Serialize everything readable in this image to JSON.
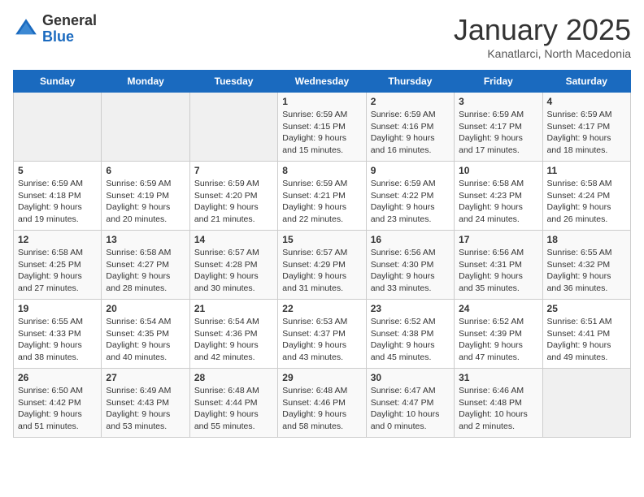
{
  "header": {
    "logo_general": "General",
    "logo_blue": "Blue",
    "title": "January 2025",
    "subtitle": "Kanatlarci, North Macedonia"
  },
  "days_of_week": [
    "Sunday",
    "Monday",
    "Tuesday",
    "Wednesday",
    "Thursday",
    "Friday",
    "Saturday"
  ],
  "weeks": [
    [
      {
        "day": "",
        "sunrise": "",
        "sunset": "",
        "daylight": ""
      },
      {
        "day": "",
        "sunrise": "",
        "sunset": "",
        "daylight": ""
      },
      {
        "day": "",
        "sunrise": "",
        "sunset": "",
        "daylight": ""
      },
      {
        "day": "1",
        "sunrise": "Sunrise: 6:59 AM",
        "sunset": "Sunset: 4:15 PM",
        "daylight": "Daylight: 9 hours and 15 minutes."
      },
      {
        "day": "2",
        "sunrise": "Sunrise: 6:59 AM",
        "sunset": "Sunset: 4:16 PM",
        "daylight": "Daylight: 9 hours and 16 minutes."
      },
      {
        "day": "3",
        "sunrise": "Sunrise: 6:59 AM",
        "sunset": "Sunset: 4:17 PM",
        "daylight": "Daylight: 9 hours and 17 minutes."
      },
      {
        "day": "4",
        "sunrise": "Sunrise: 6:59 AM",
        "sunset": "Sunset: 4:17 PM",
        "daylight": "Daylight: 9 hours and 18 minutes."
      }
    ],
    [
      {
        "day": "5",
        "sunrise": "Sunrise: 6:59 AM",
        "sunset": "Sunset: 4:18 PM",
        "daylight": "Daylight: 9 hours and 19 minutes."
      },
      {
        "day": "6",
        "sunrise": "Sunrise: 6:59 AM",
        "sunset": "Sunset: 4:19 PM",
        "daylight": "Daylight: 9 hours and 20 minutes."
      },
      {
        "day": "7",
        "sunrise": "Sunrise: 6:59 AM",
        "sunset": "Sunset: 4:20 PM",
        "daylight": "Daylight: 9 hours and 21 minutes."
      },
      {
        "day": "8",
        "sunrise": "Sunrise: 6:59 AM",
        "sunset": "Sunset: 4:21 PM",
        "daylight": "Daylight: 9 hours and 22 minutes."
      },
      {
        "day": "9",
        "sunrise": "Sunrise: 6:59 AM",
        "sunset": "Sunset: 4:22 PM",
        "daylight": "Daylight: 9 hours and 23 minutes."
      },
      {
        "day": "10",
        "sunrise": "Sunrise: 6:58 AM",
        "sunset": "Sunset: 4:23 PM",
        "daylight": "Daylight: 9 hours and 24 minutes."
      },
      {
        "day": "11",
        "sunrise": "Sunrise: 6:58 AM",
        "sunset": "Sunset: 4:24 PM",
        "daylight": "Daylight: 9 hours and 26 minutes."
      }
    ],
    [
      {
        "day": "12",
        "sunrise": "Sunrise: 6:58 AM",
        "sunset": "Sunset: 4:25 PM",
        "daylight": "Daylight: 9 hours and 27 minutes."
      },
      {
        "day": "13",
        "sunrise": "Sunrise: 6:58 AM",
        "sunset": "Sunset: 4:27 PM",
        "daylight": "Daylight: 9 hours and 28 minutes."
      },
      {
        "day": "14",
        "sunrise": "Sunrise: 6:57 AM",
        "sunset": "Sunset: 4:28 PM",
        "daylight": "Daylight: 9 hours and 30 minutes."
      },
      {
        "day": "15",
        "sunrise": "Sunrise: 6:57 AM",
        "sunset": "Sunset: 4:29 PM",
        "daylight": "Daylight: 9 hours and 31 minutes."
      },
      {
        "day": "16",
        "sunrise": "Sunrise: 6:56 AM",
        "sunset": "Sunset: 4:30 PM",
        "daylight": "Daylight: 9 hours and 33 minutes."
      },
      {
        "day": "17",
        "sunrise": "Sunrise: 6:56 AM",
        "sunset": "Sunset: 4:31 PM",
        "daylight": "Daylight: 9 hours and 35 minutes."
      },
      {
        "day": "18",
        "sunrise": "Sunrise: 6:55 AM",
        "sunset": "Sunset: 4:32 PM",
        "daylight": "Daylight: 9 hours and 36 minutes."
      }
    ],
    [
      {
        "day": "19",
        "sunrise": "Sunrise: 6:55 AM",
        "sunset": "Sunset: 4:33 PM",
        "daylight": "Daylight: 9 hours and 38 minutes."
      },
      {
        "day": "20",
        "sunrise": "Sunrise: 6:54 AM",
        "sunset": "Sunset: 4:35 PM",
        "daylight": "Daylight: 9 hours and 40 minutes."
      },
      {
        "day": "21",
        "sunrise": "Sunrise: 6:54 AM",
        "sunset": "Sunset: 4:36 PM",
        "daylight": "Daylight: 9 hours and 42 minutes."
      },
      {
        "day": "22",
        "sunrise": "Sunrise: 6:53 AM",
        "sunset": "Sunset: 4:37 PM",
        "daylight": "Daylight: 9 hours and 43 minutes."
      },
      {
        "day": "23",
        "sunrise": "Sunrise: 6:52 AM",
        "sunset": "Sunset: 4:38 PM",
        "daylight": "Daylight: 9 hours and 45 minutes."
      },
      {
        "day": "24",
        "sunrise": "Sunrise: 6:52 AM",
        "sunset": "Sunset: 4:39 PM",
        "daylight": "Daylight: 9 hours and 47 minutes."
      },
      {
        "day": "25",
        "sunrise": "Sunrise: 6:51 AM",
        "sunset": "Sunset: 4:41 PM",
        "daylight": "Daylight: 9 hours and 49 minutes."
      }
    ],
    [
      {
        "day": "26",
        "sunrise": "Sunrise: 6:50 AM",
        "sunset": "Sunset: 4:42 PM",
        "daylight": "Daylight: 9 hours and 51 minutes."
      },
      {
        "day": "27",
        "sunrise": "Sunrise: 6:49 AM",
        "sunset": "Sunset: 4:43 PM",
        "daylight": "Daylight: 9 hours and 53 minutes."
      },
      {
        "day": "28",
        "sunrise": "Sunrise: 6:48 AM",
        "sunset": "Sunset: 4:44 PM",
        "daylight": "Daylight: 9 hours and 55 minutes."
      },
      {
        "day": "29",
        "sunrise": "Sunrise: 6:48 AM",
        "sunset": "Sunset: 4:46 PM",
        "daylight": "Daylight: 9 hours and 58 minutes."
      },
      {
        "day": "30",
        "sunrise": "Sunrise: 6:47 AM",
        "sunset": "Sunset: 4:47 PM",
        "daylight": "Daylight: 10 hours and 0 minutes."
      },
      {
        "day": "31",
        "sunrise": "Sunrise: 6:46 AM",
        "sunset": "Sunset: 4:48 PM",
        "daylight": "Daylight: 10 hours and 2 minutes."
      },
      {
        "day": "",
        "sunrise": "",
        "sunset": "",
        "daylight": ""
      }
    ]
  ]
}
